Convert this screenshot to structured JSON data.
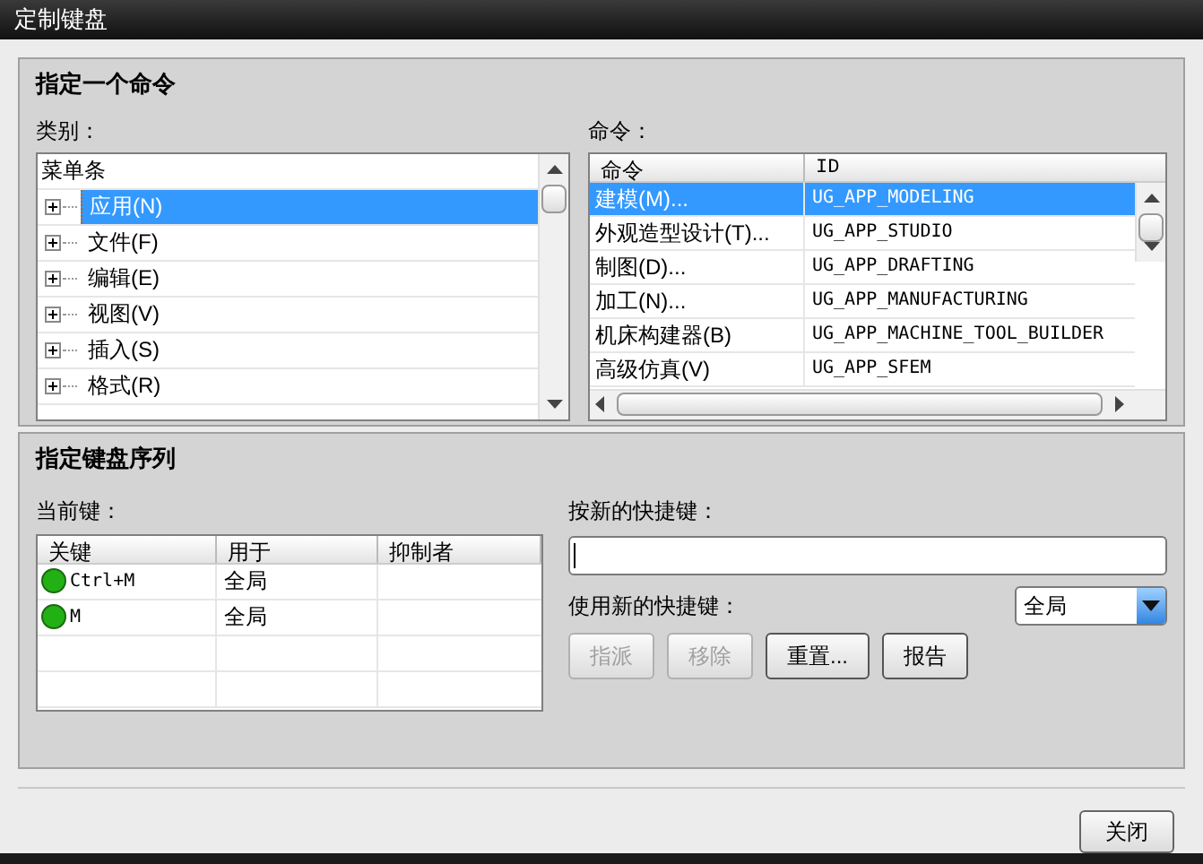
{
  "window": {
    "title": "定制键盘"
  },
  "command_section": {
    "title": "指定一个命令",
    "category_label": "类别：",
    "category_tree": {
      "root": "菜单条",
      "items": [
        {
          "label": "应用(N)",
          "selected": true
        },
        {
          "label": "文件(F)",
          "selected": false
        },
        {
          "label": "编辑(E)",
          "selected": false
        },
        {
          "label": "视图(V)",
          "selected": false
        },
        {
          "label": "插入(S)",
          "selected": false
        },
        {
          "label": "格式(R)",
          "selected": false
        }
      ]
    },
    "command_label": "命令：",
    "command_table": {
      "columns": [
        "命令",
        "ID"
      ],
      "rows": [
        {
          "command": "建模(M)...",
          "id": "UG_APP_MODELING",
          "selected": true
        },
        {
          "command": "外观造型设计(T)...",
          "id": "UG_APP_STUDIO",
          "selected": false
        },
        {
          "command": "制图(D)...",
          "id": "UG_APP_DRAFTING",
          "selected": false
        },
        {
          "command": "加工(N)...",
          "id": "UG_APP_MANUFACTURING",
          "selected": false
        },
        {
          "command": "机床构建器(B)",
          "id": "UG_APP_MACHINE_TOOL_BUILDER",
          "selected": false
        },
        {
          "command": "高级仿真(V)",
          "id": "UG_APP_SFEM",
          "selected": false
        }
      ]
    }
  },
  "sequence_section": {
    "title": "指定键盘序列",
    "current_keys_label": "当前键：",
    "keys_table": {
      "columns": [
        "关键",
        "用于",
        "抑制者"
      ],
      "rows": [
        {
          "key": "Ctrl+M",
          "used_in": "全局"
        },
        {
          "key": "M",
          "used_in": "全局"
        }
      ]
    },
    "new_shortcut_label": "按新的快捷键：",
    "use_new_label": "使用新的快捷键：",
    "scope_dropdown": {
      "value": "全局"
    },
    "buttons": [
      {
        "label": "指派",
        "disabled": true
      },
      {
        "label": "移除",
        "disabled": true
      },
      {
        "label": "重置...",
        "disabled": false
      },
      {
        "label": "报告",
        "disabled": false
      }
    ]
  },
  "footer": {
    "close_button": "关闭"
  }
}
